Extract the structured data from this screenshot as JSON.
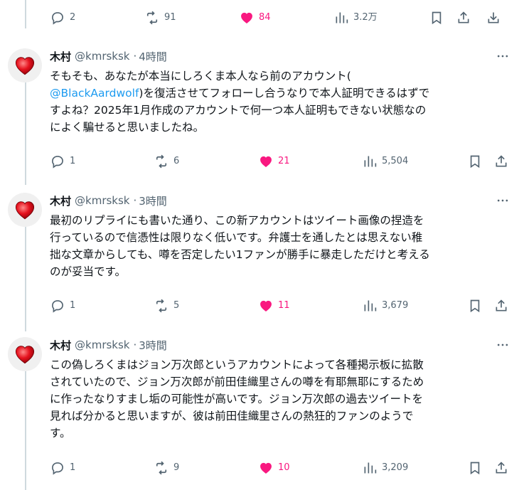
{
  "top_actions": {
    "replies": "2",
    "retweets": "91",
    "likes": "84",
    "views": "3.2万"
  },
  "tweets": [
    {
      "display_name": "木村",
      "handle": "@kmrsksk",
      "time": "4時間",
      "line1": "そもそも、あなたが本当にしろくま本人なら前のアカウント(",
      "mention": "@BlackAardwolf",
      "line2_rest": ")を復活させてフォローし合うなりで本人証明できるはずで",
      "line3": "すよね？2025年1月作成のアカウントで何一つ本人証明もできない状態なの",
      "line4": "によく騙せると思いましたね。",
      "replies": "1",
      "retweets": "6",
      "likes": "21",
      "views": "5,504"
    },
    {
      "display_name": "木村",
      "handle": "@kmrsksk",
      "time": "3時間",
      "line1": "最初のリプライにも書いた通り、この新アカウントはツイート画像の捏造を",
      "line2": "行っているので信憑性は限りなく低いです。弁護士を通したとは思えない稚",
      "line3": "拙な文章からしても、噂を否定したい1ファンが勝手に暴走しただけと考える",
      "line4": "のが妥当です。",
      "replies": "1",
      "retweets": "5",
      "likes": "11",
      "views": "3,679"
    },
    {
      "display_name": "木村",
      "handle": "@kmrsksk",
      "time": "3時間",
      "line1": "この偽しろくまはジョン万次郎というアカウントによって各種掲示板に拡散",
      "line2": "されていたので、ジョン万次郎が前田佳織里さんの噂を有耶無耶にするため",
      "line3": "に作ったなりすまし垢の可能性が高いです。ジョン万次郎の過去ツイートを",
      "line4": "見れば分かると思いますが、彼は前田佳織里さんの熱狂的ファンのようで",
      "line5": "す。",
      "replies": "1",
      "retweets": "9",
      "likes": "10",
      "views": "3,209"
    }
  ],
  "colors": {
    "text": "#0f1419",
    "muted": "#536471",
    "like": "#f91880",
    "link": "#1d9bf0",
    "thread_line": "#cfd9de"
  },
  "icons": [
    "reply-icon",
    "retweet-icon",
    "like-icon",
    "views-icon",
    "bookmark-icon",
    "share-icon",
    "download-icon",
    "more-icon",
    "heart-avatar"
  ]
}
